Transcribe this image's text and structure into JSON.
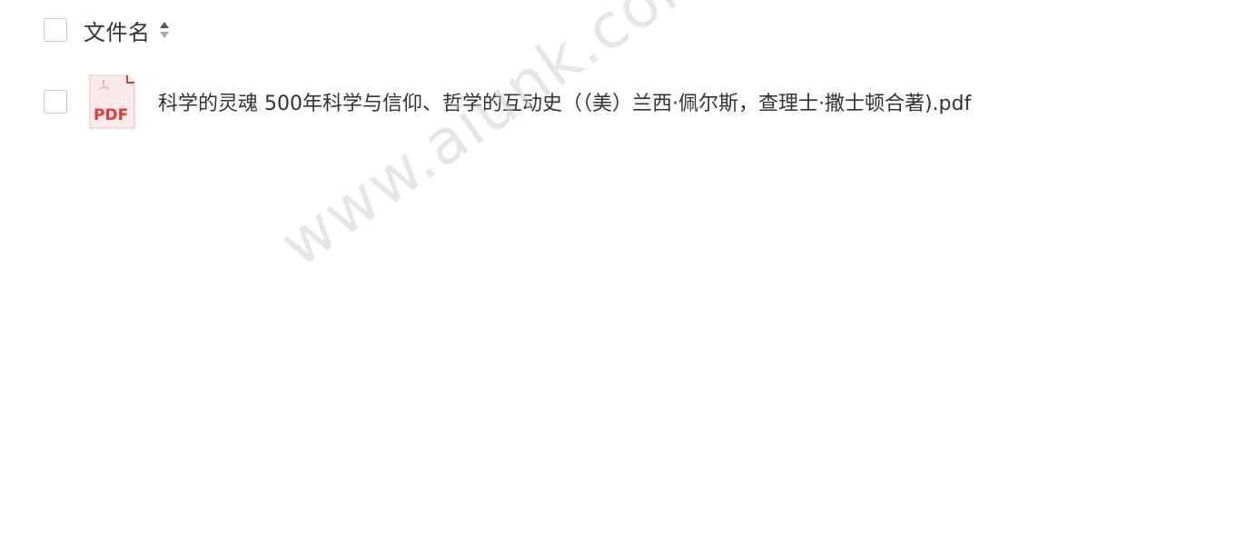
{
  "header": {
    "column_label": "文件名",
    "sort_icon": "sort-up-down-icon"
  },
  "files": [
    {
      "icon": "pdf-file-icon",
      "icon_label": "PDF",
      "name": "科学的灵魂 500年科学与信仰、哲学的互动史（（美）兰西·佩尔斯，查理士·撒士顿合著).pdf"
    }
  ],
  "watermark": "www.aiunk.com",
  "colors": {
    "pdf_red": "#d9534f",
    "checkbox_border": "#c8c8c8",
    "text": "#333333"
  }
}
